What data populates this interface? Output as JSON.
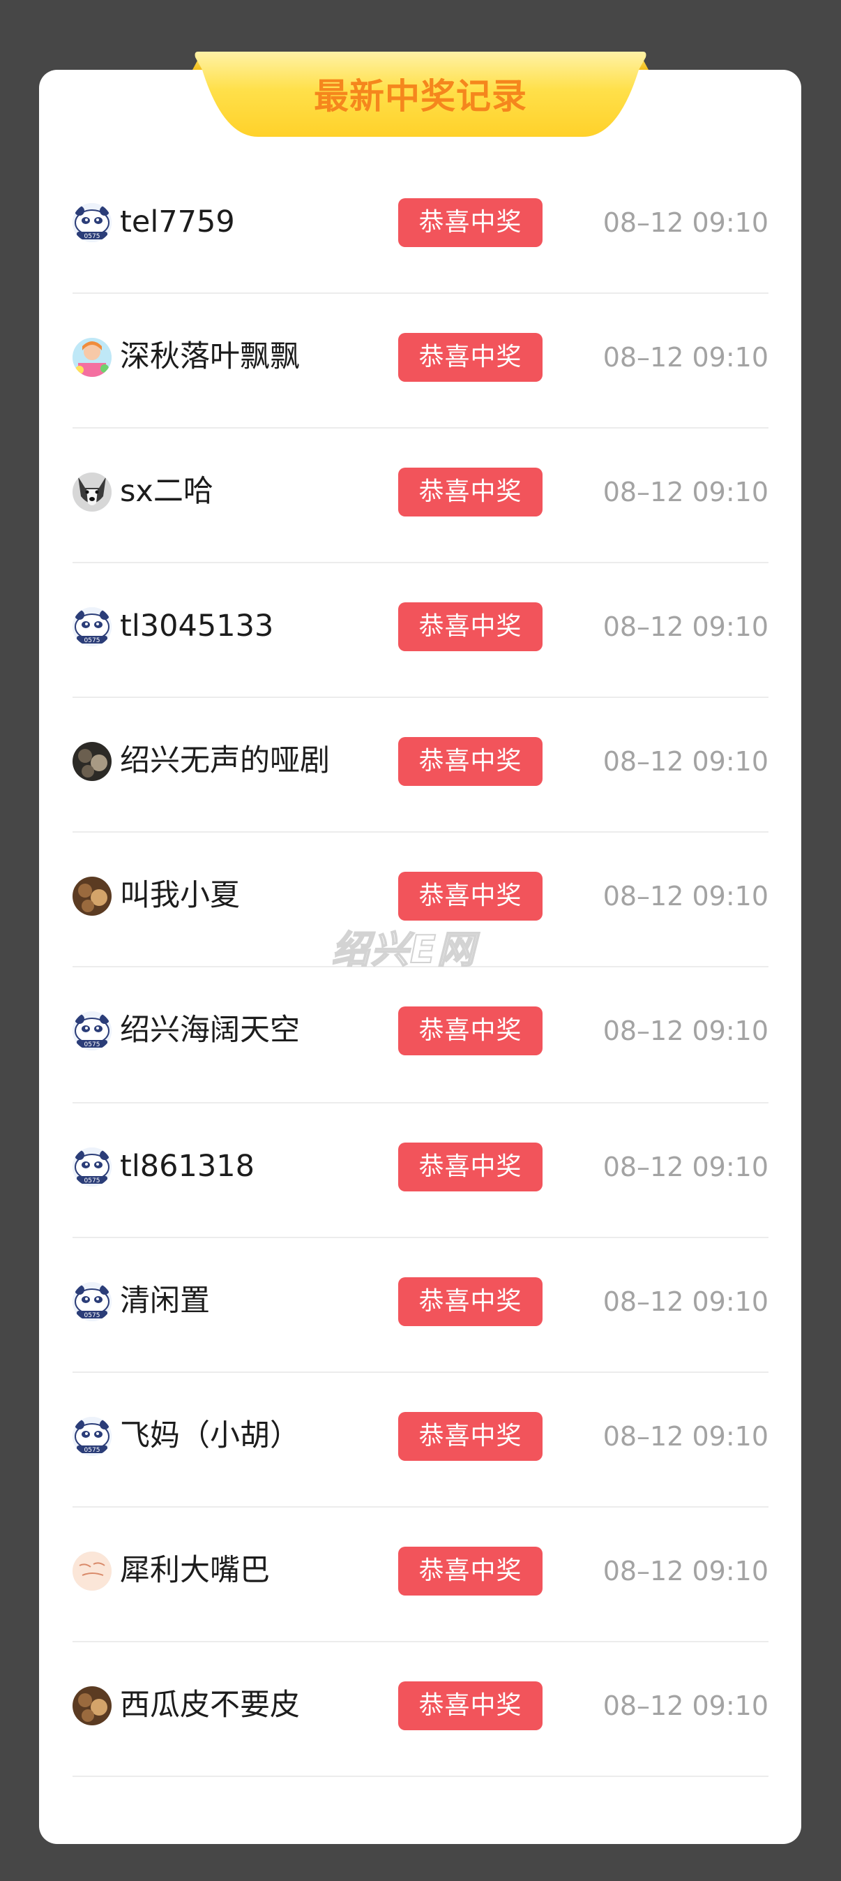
{
  "header": {
    "title": "最新中奖记录"
  },
  "watermark": "绍兴E网",
  "colors": {
    "background": "#474747",
    "card": "#ffffff",
    "ribbon_yellow": "#ffd93a",
    "title_orange": "#f5861d",
    "badge_red": "#f2545b",
    "time_gray": "#a3a3a3"
  },
  "records": [
    {
      "username": "tel7759",
      "avatar": "panda-avatar-icon",
      "badge": "恭喜中奖",
      "time": "08–12 09:10"
    },
    {
      "username": "深秋落叶飘飘",
      "avatar": "anime-avatar-icon",
      "badge": "恭喜中奖",
      "time": "08–12 09:10"
    },
    {
      "username": "sx二哈",
      "avatar": "husky-avatar-icon",
      "badge": "恭喜中奖",
      "time": "08–12 09:10"
    },
    {
      "username": "tl3045133",
      "avatar": "panda-avatar-icon",
      "badge": "恭喜中奖",
      "time": "08–12 09:10"
    },
    {
      "username": "绍兴无声的哑剧",
      "avatar": "photo-avatar-icon",
      "badge": "恭喜中奖",
      "time": "08–12 09:10"
    },
    {
      "username": "叫我小夏",
      "avatar": "photo-avatar-icon",
      "badge": "恭喜中奖",
      "time": "08–12 09:10"
    },
    {
      "username": "绍兴海阔天空",
      "avatar": "panda-avatar-icon",
      "badge": "恭喜中奖",
      "time": "08–12 09:10"
    },
    {
      "username": "tl861318",
      "avatar": "panda-avatar-icon",
      "badge": "恭喜中奖",
      "time": "08–12 09:10"
    },
    {
      "username": "清闲置",
      "avatar": "panda-avatar-icon",
      "badge": "恭喜中奖",
      "time": "08–12 09:10"
    },
    {
      "username": "飞妈（小胡）",
      "avatar": "panda-avatar-icon",
      "badge": "恭喜中奖",
      "time": "08–12 09:10"
    },
    {
      "username": "犀利大嘴巴",
      "avatar": "text-avatar-icon",
      "badge": "恭喜中奖",
      "time": "08–12 09:10"
    },
    {
      "username": "西瓜皮不要皮",
      "avatar": "photo-avatar-icon",
      "badge": "恭喜中奖",
      "time": "08–12 09:10"
    }
  ]
}
